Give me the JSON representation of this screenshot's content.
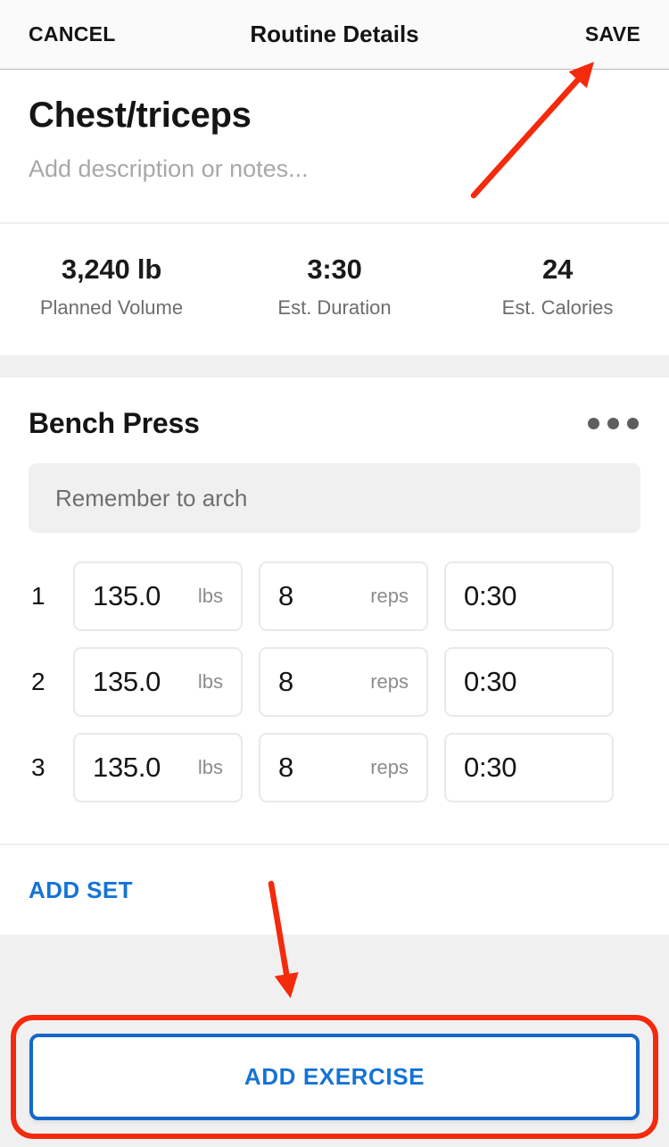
{
  "nav": {
    "cancel_label": "CANCEL",
    "title": "Routine Details",
    "save_label": "SAVE"
  },
  "routine": {
    "title": "Chest/triceps",
    "description_placeholder": "Add description or notes...",
    "description_value": ""
  },
  "stats": [
    {
      "value": "3,240 lb",
      "label": "Planned Volume"
    },
    {
      "value": "3:30",
      "label": "Est. Duration"
    },
    {
      "value": "24",
      "label": "Est. Calories"
    }
  ],
  "exercise": {
    "name": "Bench Press",
    "menu_icon": "more-horizontal-icon",
    "note_value": "Remember to arch",
    "sets": [
      {
        "index": "1",
        "weight": "135.0",
        "weight_unit": "lbs",
        "reps": "8",
        "reps_unit": "reps",
        "time": "0:30"
      },
      {
        "index": "2",
        "weight": "135.0",
        "weight_unit": "lbs",
        "reps": "8",
        "reps_unit": "reps",
        "time": "0:30"
      },
      {
        "index": "3",
        "weight": "135.0",
        "weight_unit": "lbs",
        "reps": "8",
        "reps_unit": "reps",
        "time": "0:30"
      }
    ],
    "add_set_label": "ADD SET"
  },
  "footer": {
    "add_exercise_label": "ADD EXERCISE"
  },
  "colors": {
    "accent_blue": "#1573d6",
    "button_border_blue": "#1567c8",
    "annotation_red": "#f42a0c",
    "text_dark": "#151515",
    "text_muted": "#6d6d6d",
    "placeholder_gray": "#a8a8a8",
    "band_gray": "#f0f0f0"
  },
  "annotations": {
    "arrow_to_save": "arrow-pointing-to-save-button",
    "arrow_to_add_exercise": "arrow-pointing-to-add-exercise-button",
    "highlight_box": "red-highlight-around-add-exercise"
  }
}
